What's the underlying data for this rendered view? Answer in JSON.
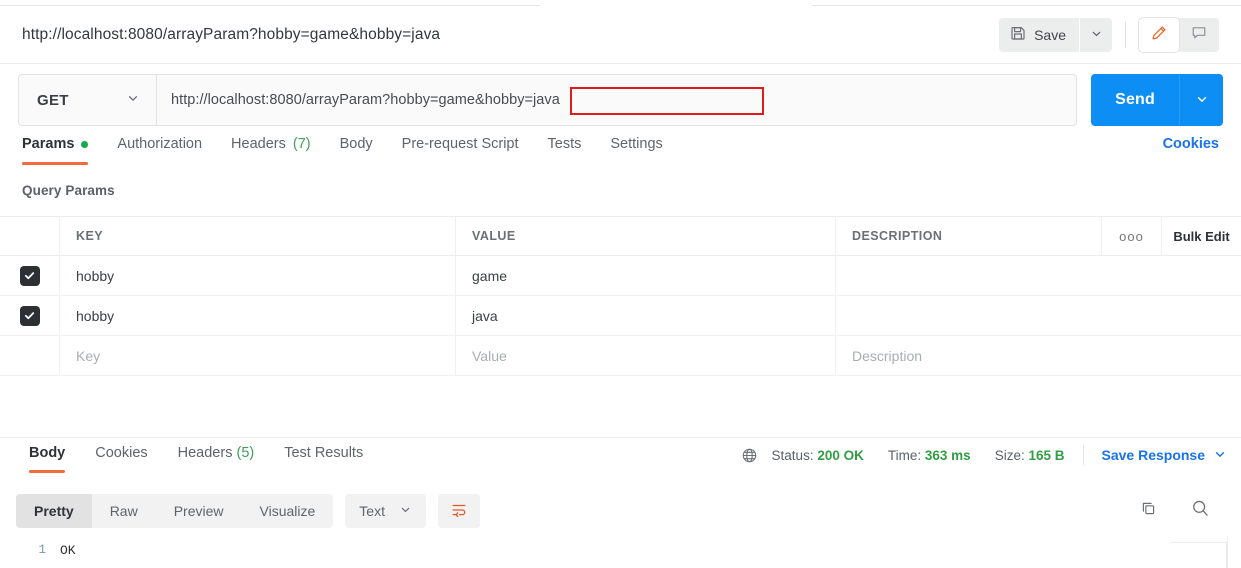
{
  "window": {
    "request_title": "http://localhost:8080/arrayParam?hobby=game&hobby=java"
  },
  "toolbar": {
    "save_label": "Save",
    "save_icon": "floppy-disk-icon",
    "save_caret_icon": "chevron-down-icon",
    "edit_icon": "pencil-icon",
    "comment_icon": "comment-icon"
  },
  "url_bar": {
    "method": "GET",
    "method_caret_icon": "chevron-down-icon",
    "url": "http://localhost:8080/arrayParam?hobby=game&hobby=java",
    "highlight_text": "hobby=game&hobby=java",
    "highlight_color": "#e01b1b",
    "send_label": "Send",
    "send_caret_icon": "chevron-down-icon",
    "send_color": "#0d8ef5"
  },
  "request_tabs": {
    "items": [
      {
        "label": "Params",
        "badge": "dot",
        "active": true
      },
      {
        "label": "Authorization",
        "badge": "",
        "active": false
      },
      {
        "label": "Headers",
        "count": "(7)",
        "active": false
      },
      {
        "label": "Body",
        "badge": "",
        "active": false
      },
      {
        "label": "Pre-request Script",
        "badge": "",
        "active": false
      },
      {
        "label": "Tests",
        "badge": "",
        "active": false
      },
      {
        "label": "Settings",
        "badge": "",
        "active": false
      }
    ],
    "cookies_link": "Cookies",
    "active_underline_color": "#f26b3a",
    "dot_color": "#16a94a"
  },
  "query_params": {
    "section_label": "Query Params",
    "columns": {
      "key": "KEY",
      "value": "VALUE",
      "description": "DESCRIPTION",
      "more_icon": "ellipsis-icon",
      "bulk_edit": "Bulk Edit"
    },
    "rows": [
      {
        "checked": true,
        "key": "hobby",
        "value": "game",
        "description": ""
      },
      {
        "checked": true,
        "key": "hobby",
        "value": "java",
        "description": ""
      }
    ],
    "placeholder_row": {
      "key": "Key",
      "value": "Value",
      "description": "Description"
    }
  },
  "response_tabs": {
    "items": [
      {
        "label": "Body",
        "count": "",
        "active": true
      },
      {
        "label": "Cookies",
        "count": "",
        "active": false
      },
      {
        "label": "Headers",
        "count": "(5)",
        "active": false
      },
      {
        "label": "Test Results",
        "count": "",
        "active": false
      }
    ]
  },
  "response_status": {
    "globe_icon": "globe-icon",
    "status_label": "Status:",
    "status_value": "200 OK",
    "time_label": "Time:",
    "time_value": "363 ms",
    "size_label": "Size:",
    "size_value": "165 B",
    "save_response": "Save Response",
    "save_response_caret_icon": "chevron-down-icon",
    "ok_color": "#2f9e44",
    "link_color": "#1a73e8"
  },
  "body_toolbar": {
    "formats": [
      {
        "label": "Pretty",
        "active": true
      },
      {
        "label": "Raw",
        "active": false
      },
      {
        "label": "Preview",
        "active": false
      },
      {
        "label": "Visualize",
        "active": false
      }
    ],
    "type_select": "Text",
    "type_caret_icon": "chevron-down-icon",
    "wrap_icon": "word-wrap-icon",
    "copy_icon": "copy-icon",
    "search_icon": "search-icon"
  },
  "response_body": {
    "lines": [
      {
        "no": "1",
        "text": "OK"
      }
    ]
  }
}
